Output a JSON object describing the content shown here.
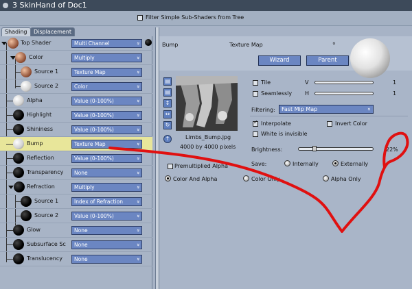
{
  "window": {
    "title": "3  SkinHand of Doc1"
  },
  "filter": {
    "label": "Filter Simple Sub-Shaders from Tree",
    "checked": false
  },
  "tabs": [
    {
      "label": "Shading",
      "active": true
    },
    {
      "label": "Displacement",
      "active": false
    }
  ],
  "tree": {
    "rows": [
      {
        "label": "Top Shader",
        "value": "Multi Channel",
        "sphere": "brown"
      },
      {
        "label": "Color",
        "value": "Multiply",
        "sphere": "brown"
      },
      {
        "label": "Source 1",
        "value": "Texture Map",
        "sphere": "brown"
      },
      {
        "label": "Source 2",
        "value": "Color",
        "sphere": "white"
      },
      {
        "label": "Alpha",
        "value": "Value (0-100%)",
        "sphere": "white"
      },
      {
        "label": "Highlight",
        "value": "Value (0-100%)",
        "sphere": "black"
      },
      {
        "label": "Shininess",
        "value": "Value (0-100%)",
        "sphere": "black"
      },
      {
        "label": "Bump",
        "value": "Texture Map",
        "sphere": "white"
      },
      {
        "label": "Reflection",
        "value": "Value (0-100%)",
        "sphere": "black"
      },
      {
        "label": "Transparency",
        "value": "None",
        "sphere": "black"
      },
      {
        "label": "Refraction",
        "value": "Multiply",
        "sphere": "black"
      },
      {
        "label": "Source 1",
        "value": "Index of Refraction",
        "sphere": "black"
      },
      {
        "label": "Source 2",
        "value": "Value (0-100%)",
        "sphere": "black"
      },
      {
        "label": "Glow",
        "value": "None",
        "sphere": "black"
      },
      {
        "label": "Subsurface Sc",
        "value": "None",
        "sphere": "black"
      },
      {
        "label": "Translucency",
        "value": "None",
        "sphere": "black"
      }
    ]
  },
  "detail": {
    "channel": "Bump",
    "type": "Texture Map",
    "wizard_label": "Wizard",
    "parent_label": "Parent",
    "image_name": "Limbs_Bump.jpg",
    "image_size": "4000 by 4000 pixels",
    "tile_label": "Tile",
    "seamlessly_label": "Seamlessly",
    "v_label": "V",
    "h_label": "H",
    "v_value": "1",
    "h_value": "1",
    "filtering_label": "Filtering:",
    "filtering_value": "Fast Mip Map",
    "interpolate_label": "Interpolate",
    "invert_label": "Invert Color",
    "white_invisible_label": "White is invisible",
    "brightness_label": "Brightness:",
    "brightness_value": "22%",
    "brightness_level": 0.22,
    "save_label": "Save:",
    "internally_label": "Internally",
    "externally_label": "Externally",
    "premultiplied_label": "Premultiplied Alpha",
    "color_alpha_label": "Color And Alpha",
    "color_only_label": "Color Only",
    "alpha_only_label": "Alpha Only"
  },
  "colors": {
    "accent": "#6b86c2",
    "selection": "#e8e69a",
    "annotation": "#e01010"
  }
}
